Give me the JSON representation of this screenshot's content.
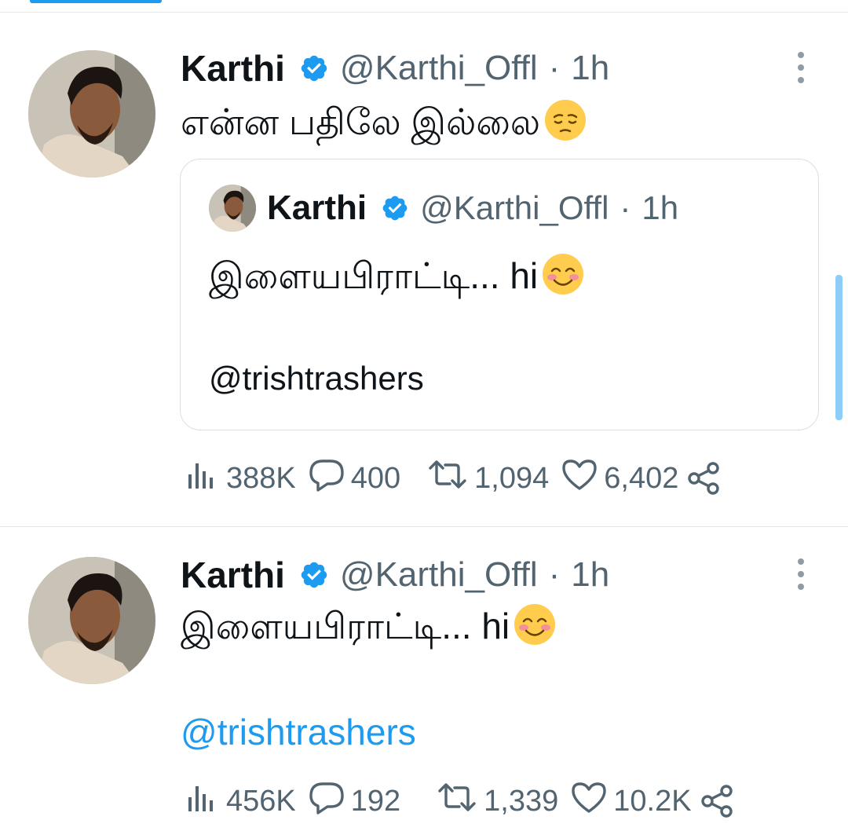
{
  "tweets": [
    {
      "author_name": "Karthi",
      "handle": "@Karthi_Offl",
      "separator": "·",
      "time": "1h",
      "text": "என்ன பதிலே இல்லை",
      "text_emoji": "pensive-face",
      "quote": {
        "author_name": "Karthi",
        "handle": "@Karthi_Offl",
        "separator": "·",
        "time": "1h",
        "text": "இளையபிராட்டி... hi",
        "text_emoji": "smiling-face-with-smiling-eyes",
        "mention": "@trishtrashers"
      },
      "stats": {
        "views": "388K",
        "replies": "400",
        "retweets": "1,094",
        "likes": "6,402"
      }
    },
    {
      "author_name": "Karthi",
      "handle": "@Karthi_Offl",
      "separator": "·",
      "time": "1h",
      "text": "இளையபிராட்டி... hi",
      "text_emoji": "smiling-face-with-smiling-eyes",
      "mention": "@trishtrashers",
      "stats": {
        "views": "456K",
        "replies": "192",
        "retweets": "1,339",
        "likes": "10.2K"
      }
    }
  ],
  "colors": {
    "accent": "#1d9bf0",
    "secondary_text": "#536471",
    "primary_text": "#0f1419",
    "divider": "#e6e9eb"
  }
}
